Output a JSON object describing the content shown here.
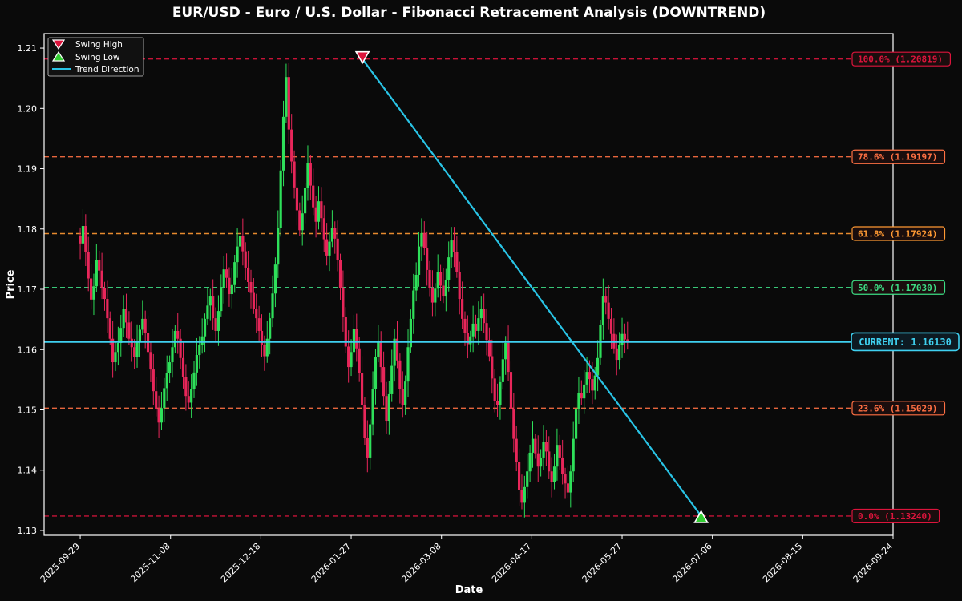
{
  "chart_data": {
    "type": "candlestick",
    "title": "EUR/USD - Euro / U.S. Dollar - Fibonacci Retracement Analysis (DOWNTREND)",
    "xlabel": "Date",
    "ylabel": "Price",
    "xlim": [
      "2025-09-13",
      "2026-09-24"
    ],
    "ylim": [
      1.1292,
      1.2124
    ],
    "x_ticks": [
      "2025-09-29",
      "2025-11-08",
      "2025-12-18",
      "2026-01-27",
      "2026-03-08",
      "2026-04-17",
      "2026-05-27",
      "2026-07-06",
      "2026-08-15",
      "2026-09-24"
    ],
    "y_ticks": [
      "1.13",
      "1.14",
      "1.15",
      "1.16",
      "1.17",
      "1.18",
      "1.19",
      "1.20",
      "1.21"
    ],
    "grid": false,
    "legend_position": "top-left",
    "legend": [
      {
        "label": "Swing High",
        "marker": "triangle-down",
        "color": "#dc143c"
      },
      {
        "label": "Swing Low",
        "marker": "triangle-up",
        "color": "#32cd32"
      },
      {
        "label": "Trend Direction",
        "marker": "line",
        "color": "#29c4e6"
      }
    ],
    "colors": {
      "up": "#2ee05a",
      "down": "#e8265a",
      "trend": "#29c4e6",
      "current": "#3fd0f0"
    },
    "swing_high": {
      "date": "2026-02-01",
      "price": 1.20819
    },
    "swing_low": {
      "date": "2026-07-01",
      "price": 1.1324
    },
    "current": {
      "price": 1.1613,
      "label": "CURRENT: 1.16130"
    },
    "fib_levels": [
      {
        "label": "100.0% (1.20819)",
        "price": 1.20819,
        "color": "#dc143c"
      },
      {
        "label": "78.6% (1.19197)",
        "price": 1.19197,
        "color": "#ff7043"
      },
      {
        "label": "61.8% (1.17924)",
        "price": 1.17924,
        "color": "#ff9933"
      },
      {
        "label": "50.0% (1.17030)",
        "price": 1.1703,
        "color": "#3ddc84"
      },
      {
        "label": "23.6% (1.15029)",
        "price": 1.15029,
        "color": "#ff7043"
      },
      {
        "label": "0.0% (1.13240)",
        "price": 1.1324,
        "color": "#dc143c"
      }
    ],
    "series_start_date": "2025-09-29",
    "series_step_days": 1.2,
    "series": [
      {
        "name": "Close",
        "values": [
          1.1776,
          1.1805,
          1.1762,
          1.1718,
          1.1683,
          1.1705,
          1.1748,
          1.1731,
          1.1702,
          1.1684,
          1.1652,
          1.1618,
          1.1579,
          1.1596,
          1.1611,
          1.1636,
          1.1667,
          1.1645,
          1.1618,
          1.1604,
          1.1588,
          1.1612,
          1.1633,
          1.1651,
          1.1628,
          1.1596,
          1.1567,
          1.1531,
          1.1502,
          1.1479,
          1.1503,
          1.1536,
          1.1561,
          1.1579,
          1.1604,
          1.1631,
          1.1618,
          1.1586,
          1.1555,
          1.1523,
          1.1512,
          1.1534,
          1.1562,
          1.1591,
          1.1608,
          1.1622,
          1.1651,
          1.1673,
          1.1688,
          1.1652,
          1.1631,
          1.1664,
          1.1702,
          1.1733,
          1.1719,
          1.1692,
          1.1707,
          1.1745,
          1.1771,
          1.1788,
          1.1763,
          1.1736,
          1.1712,
          1.1694,
          1.1668,
          1.1652,
          1.1631,
          1.1608,
          1.1589,
          1.1618,
          1.1652,
          1.1693,
          1.1741,
          1.1802,
          1.1897,
          1.1986,
          1.2052,
          1.1965,
          1.1912,
          1.1869,
          1.1831,
          1.1798,
          1.1826,
          1.1868,
          1.1909,
          1.1872,
          1.1836,
          1.1812,
          1.1846,
          1.1818,
          1.1783,
          1.1756,
          1.1779,
          1.1802,
          1.1784,
          1.1748,
          1.1702,
          1.1654,
          1.1605,
          1.1571,
          1.1596,
          1.1634,
          1.1602,
          1.1561,
          1.1508,
          1.1453,
          1.1421,
          1.1476,
          1.1534,
          1.1588,
          1.1612,
          1.1571,
          1.1523,
          1.1482,
          1.1526,
          1.1573,
          1.1618,
          1.1582,
          1.1534,
          1.1508,
          1.1547,
          1.1604,
          1.1651,
          1.1698,
          1.1724,
          1.1771,
          1.1793,
          1.1768,
          1.1732,
          1.1702,
          1.1678,
          1.1701,
          1.1728,
          1.1706,
          1.1688,
          1.1716,
          1.1753,
          1.1781,
          1.1762,
          1.1728,
          1.1684,
          1.1651,
          1.1627,
          1.1609,
          1.1622,
          1.1643,
          1.1631,
          1.1652,
          1.1668,
          1.1644,
          1.1616,
          1.1589,
          1.1552,
          1.1514,
          1.1508,
          1.1546,
          1.1584,
          1.1611,
          1.1563,
          1.1501,
          1.1452,
          1.1413,
          1.1367,
          1.1346,
          1.1372,
          1.1398,
          1.1429,
          1.1452,
          1.1428,
          1.1406,
          1.1421,
          1.1447,
          1.1431,
          1.1398,
          1.1381,
          1.1406,
          1.1442,
          1.1421,
          1.1393,
          1.1378,
          1.1363,
          1.1398,
          1.1452,
          1.1501,
          1.1528,
          1.1519,
          1.1542,
          1.1563,
          1.1551,
          1.1532,
          1.1557,
          1.1586,
          1.1641,
          1.1688,
          1.1678,
          1.1651,
          1.1626,
          1.1602,
          1.1583,
          1.1607,
          1.1626,
          1.1617,
          1.1613
        ]
      }
    ]
  }
}
